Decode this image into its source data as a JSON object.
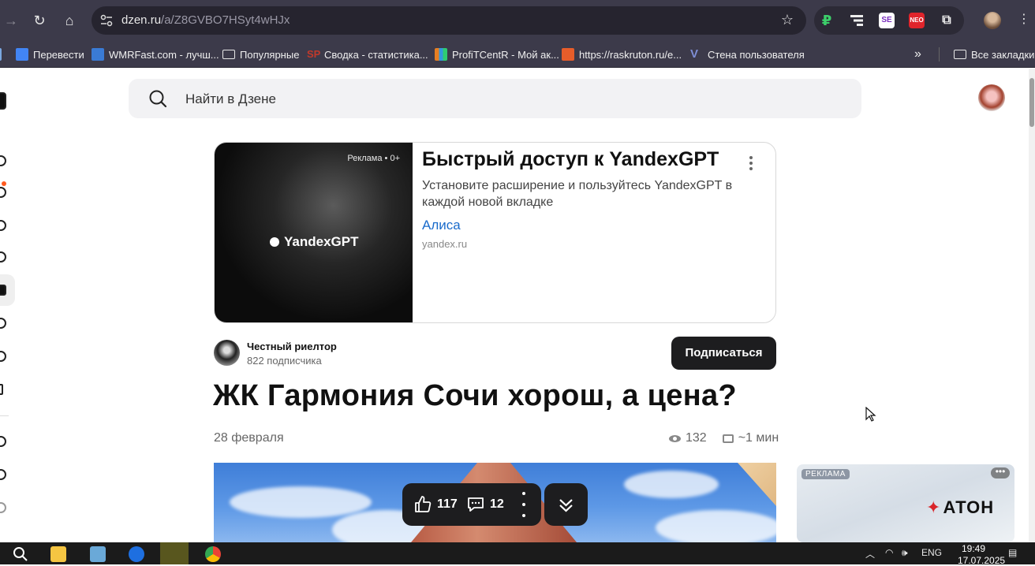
{
  "browser": {
    "url_host": "dzen.ru",
    "url_path": "/a/Z8GVBO7HSyt4wHJx",
    "extensions": [
      "ruble-extension-icon",
      "layers-extension-icon",
      "se-extension-icon",
      "neo-extension-icon",
      "puzzle-extensions-icon"
    ],
    "ext_labels": {
      "se": "SE",
      "neo": "NEO"
    }
  },
  "bookmarks": {
    "items": [
      {
        "label": "Перевести",
        "icon_color": "#4285f4"
      },
      {
        "label": "WMRFast.com - лучш...",
        "icon_color": "#3a7bd5"
      },
      {
        "label": "Популярные",
        "icon_color": "folder"
      },
      {
        "label": "Сводка - статистика...",
        "icon_color": "#c0392b"
      },
      {
        "label": "ProfiTCentR - Мой ак...",
        "icon_color": "#e67e22"
      },
      {
        "label": "https://raskruton.ru/e...",
        "icon_color": "#e85d2a"
      },
      {
        "label": "Стена пользователя",
        "icon_color": "#7f8fd6"
      }
    ],
    "more": "»",
    "all_label": "Все закладки"
  },
  "search": {
    "placeholder": "Найти в Дзене"
  },
  "ad": {
    "badge": "Реклама • 0+",
    "brand": "YandexGPT",
    "title": "Быстрый доступ к YandexGPT",
    "description": "Установите расширение и пользуйтесь YandexGPT в каждой новой вкладке",
    "link": "Алиса",
    "domain": "yandex.ru"
  },
  "author": {
    "name": "Честный риелтор",
    "subscribers": "822 подписчика"
  },
  "subscribe_label": "Подписаться",
  "article": {
    "title": "ЖК Гармония Сочи хорош, а цена?",
    "date": "28 февраля",
    "views": "132",
    "read_time": "~1 мин"
  },
  "actions": {
    "likes": "117",
    "comments": "12"
  },
  "side_ad": {
    "badge": "РЕКЛАМА",
    "brand": "АТОН"
  },
  "taskbar": {
    "lang": "ENG",
    "time": "19:49",
    "date": "17.07.2025"
  }
}
